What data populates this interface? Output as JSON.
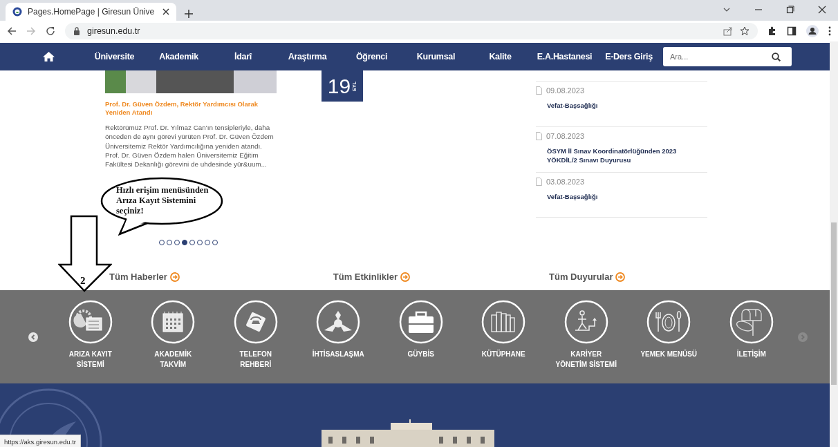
{
  "browser": {
    "tab_title": "Pages.HomePage | Giresun Ünive",
    "url": "giresun.edu.tr",
    "status_url": "https://aks.giresun.edu.tr"
  },
  "nav": {
    "items": [
      "Üniversite",
      "Akademik",
      "İdarî",
      "Araştırma",
      "Öğrenci",
      "Kurumsal",
      "Kalite",
      "E.A.Hastanesi",
      "E-Ders Giriş"
    ],
    "search": {
      "placeholder": "Ara..."
    }
  },
  "news": {
    "title": "Prof. Dr. Güven Özdem, Rektör Yardımcısı Olarak Yeniden Atandı",
    "excerpt": "Rektörümüz Prof. Dr. Yılmaz Can'ın tensipleriyle, daha önceden de aynı görevi yürüten Prof. Dr. Güven Özdem Üniversitemiz Rektör Yardımcılığına yeniden atandı. Prof. Dr. Güven Özdem halen Üniversitemiz Eğitim Fakültesi Dekanlığı görevini de uhdesinde yür&uum..."
  },
  "slider_dots": [
    {
      "selected": false
    },
    {
      "selected": false
    },
    {
      "selected": false
    },
    {
      "selected": true
    },
    {
      "selected": false
    },
    {
      "selected": false
    },
    {
      "selected": false
    },
    {
      "selected": false
    }
  ],
  "event_date": {
    "day": "19",
    "month": "EYL"
  },
  "announcements": [
    {
      "date": "09.08.2023",
      "title": "Vefat-Başsağlığı"
    },
    {
      "date": "07.08.2023",
      "title": "ÖSYM İl Sınav Koordinatörlüğünden 2023 YÖKDİL/2 Sınavı Duyurusu"
    },
    {
      "date": "03.08.2023",
      "title": "Vefat-Başsağlığı"
    }
  ],
  "all_links": [
    "Tüm Haberler",
    "Tüm Etkinlikler",
    "Tüm Duyurular"
  ],
  "quick_access": [
    {
      "label": "ARIZA KAYIT SİSTEMİ"
    },
    {
      "label": "AKADEMİK TAKVİM"
    },
    {
      "label": "TELEFON REHBERİ"
    },
    {
      "label": "İHTİSASLAŞMA"
    },
    {
      "label": "GÜYBİS"
    },
    {
      "label": "KÜTÜPHANE"
    },
    {
      "label": "KARİYER YÖNETİM SİSTEMİ"
    },
    {
      "label": "YEMEK MENÜSÜ"
    },
    {
      "label": "İLETİŞİM"
    }
  ],
  "annotation": {
    "bubble_text": "Hızlı erişim menüsünden Arıza Kayıt Sistemini seçiniz!",
    "step": "2"
  }
}
